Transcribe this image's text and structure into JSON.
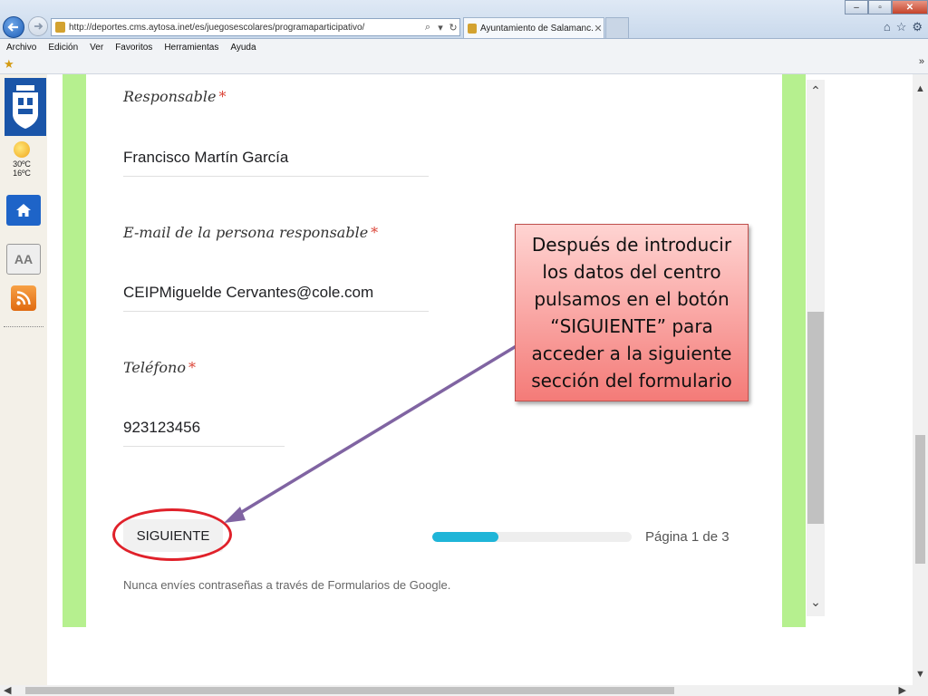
{
  "browser": {
    "url": "http://deportes.cms.aytosa.inet/es/juegosescolares/programaparticipativo/",
    "tab_title": "Ayuntamiento de Salamanc...",
    "window_controls": {
      "minimize": "–",
      "maximize": "▫",
      "close": "✕"
    },
    "menu": [
      "Archivo",
      "Edición",
      "Ver",
      "Favoritos",
      "Herramientas",
      "Ayuda"
    ]
  },
  "sidebar": {
    "weather": {
      "high": "30ºC",
      "low": "16ºC"
    },
    "text_button": "AA"
  },
  "form": {
    "fields": [
      {
        "label": "Responsable",
        "required": "*",
        "value": "Francisco Martín García"
      },
      {
        "label": "E-mail de la persona responsable",
        "required": "*",
        "value": "CEIPMiguelde Cervantes@cole.com"
      },
      {
        "label": "Teléfono",
        "required": "*",
        "value": "923123456"
      }
    ],
    "next_button": "SIGUIENTE",
    "progress": {
      "current_page": 1,
      "total_pages": 3,
      "fraction": 0.33
    },
    "page_indicator": "Página 1 de 3",
    "password_warning": "Nunca envíes contraseñas a través de Formularios de Google."
  },
  "callout": {
    "lines": [
      "Después de introducir",
      "los datos del centro",
      "pulsamos en el botón",
      "“SIGUIENTE” para",
      "acceder a la siguiente",
      "sección del formulario"
    ]
  },
  "colors": {
    "form_border": "#b6f08f",
    "progress_fill": "#1fb5d8",
    "callout_border": "#c0504d",
    "highlight_ring": "#e0212a",
    "arrow": "#8064a2"
  }
}
